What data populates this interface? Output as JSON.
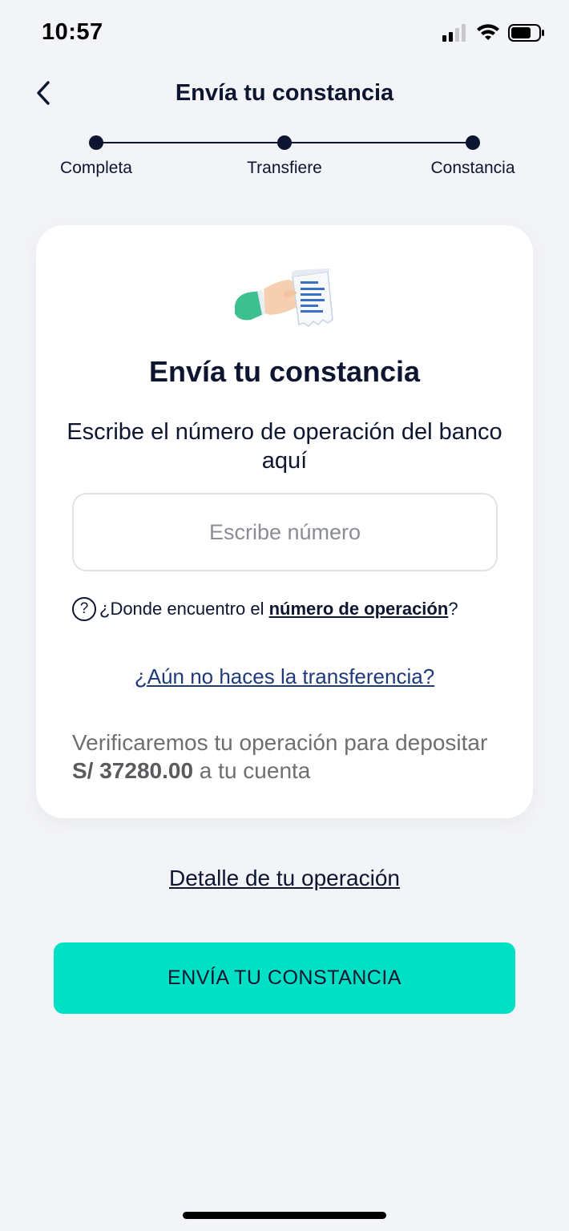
{
  "status_bar": {
    "time": "10:57"
  },
  "header": {
    "title": "Envía tu constancia"
  },
  "stepper": {
    "steps": [
      {
        "label": "Completa"
      },
      {
        "label": "Transfiere"
      },
      {
        "label": "Constancia"
      }
    ]
  },
  "card": {
    "title": "Envía tu constancia",
    "subtitle": "Escribe el número de operación del banco aquí",
    "input": {
      "placeholder": "Escribe número",
      "value": ""
    },
    "help": {
      "prefix": "¿Donde encuentro el ",
      "link": "número de operación",
      "suffix": "?"
    },
    "no_transfer_link": "¿Aún no haces la transferencia?",
    "verify": {
      "prefix": "Verificaremos tu operación para depositar ",
      "amount": "S/ 37280.00",
      "suffix": " a tu cuenta"
    }
  },
  "detail_link": "Detalle de tu operación",
  "cta": {
    "label": "ENVÍA TU CONSTANCIA"
  },
  "colors": {
    "background": "#f3f4f8",
    "primary_text": "#0d1530",
    "accent": "#00e0c4",
    "link": "#1f3a7a"
  }
}
